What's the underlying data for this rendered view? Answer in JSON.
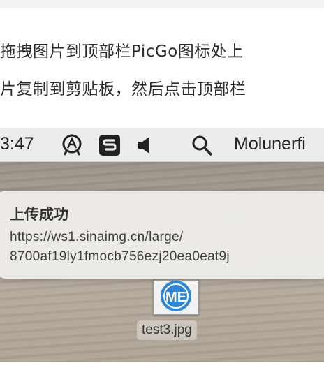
{
  "article": {
    "line1": "拖拽图片到顶部栏PicGo图标处上",
    "line2": "片复制到剪贴板，然后点击顶部栏"
  },
  "menubar": {
    "time": "3:47",
    "app_name": "Molunerfi",
    "icons": [
      "fontface-icon",
      "s-logo-icon",
      "speaker-icon",
      "spotlight-search-icon"
    ]
  },
  "notification": {
    "title": "上传成功",
    "url_line1": "https://ws1.sinaimg.cn/large/",
    "url_line2": "8700af19ly1fmocb756ezj20ea0eat9j"
  },
  "desktop_file": {
    "icon_text": "ME",
    "name": "test3.jpg"
  }
}
